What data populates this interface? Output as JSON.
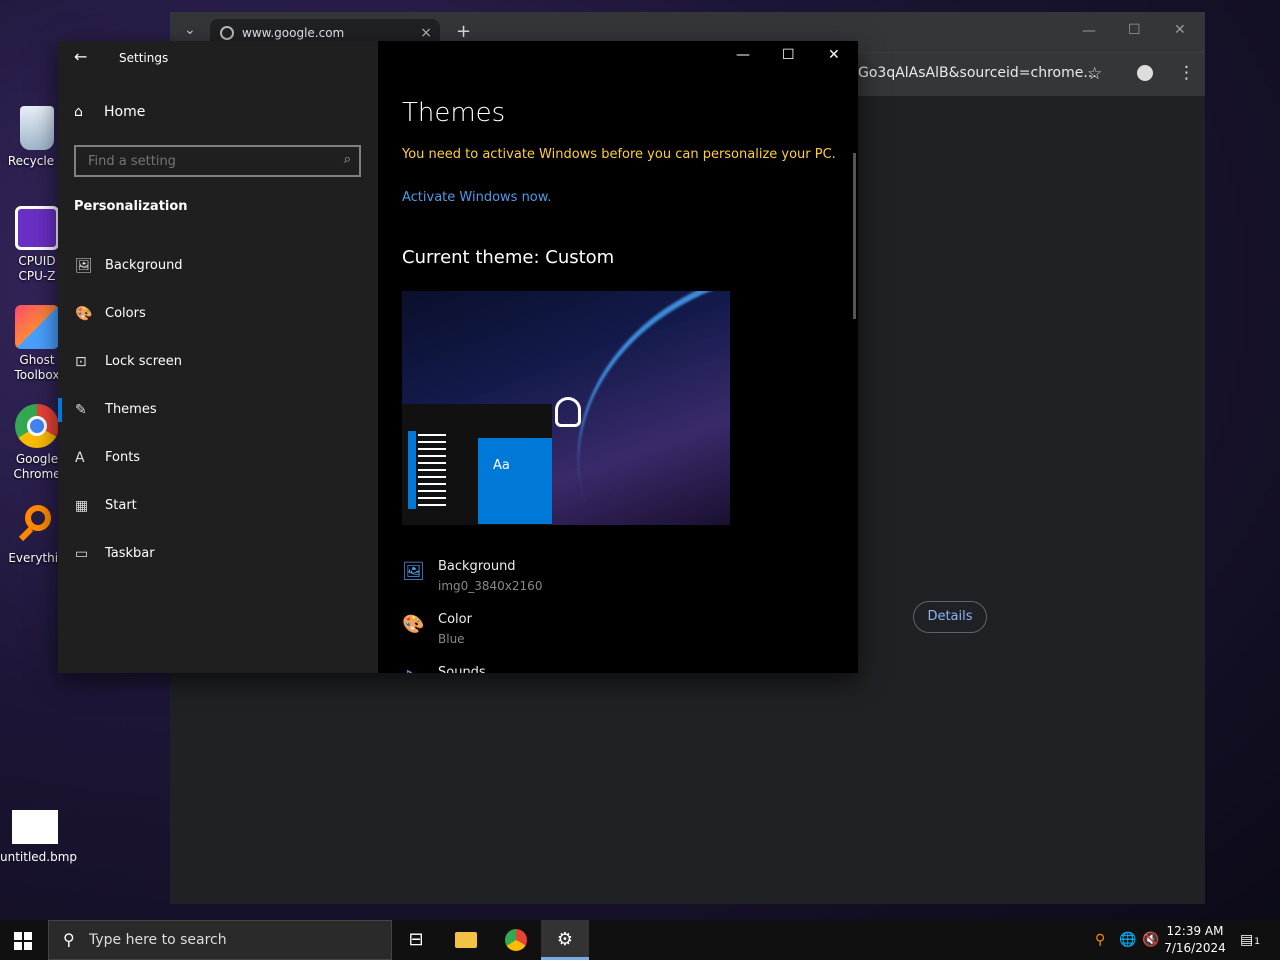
{
  "desktop": {
    "icons": [
      {
        "label": "Recycle B",
        "icon": "recycle-bin-icon"
      },
      {
        "label": "CPUID\nCPU-Z",
        "icon": "cpuz-icon"
      },
      {
        "label": "Ghost\nToolbox",
        "icon": "ghost-toolbox-icon"
      },
      {
        "label": "Google\nChrome",
        "icon": "chrome-icon"
      },
      {
        "label": "Everythin",
        "icon": "everything-search-icon"
      },
      {
        "label": "untitled.bmp",
        "icon": "bitmap-file-icon"
      }
    ]
  },
  "chrome": {
    "tab_title": "www.google.com",
    "tab_close": "×",
    "new_tab": "+",
    "url_fragment": "Go3qAlAsAlB&sourceid=chrome...",
    "details_label": "Details",
    "controls": {
      "minimize": "—",
      "maximize": "☐",
      "close": "✕"
    },
    "star": "☆",
    "menu": "⋮"
  },
  "settings": {
    "window_title": "Settings",
    "back": "←",
    "home_label": "Home",
    "search_placeholder": "Find a setting",
    "section_title": "Personalization",
    "nav": [
      {
        "label": "Background",
        "icon": "background-image-icon",
        "glyph": "🖼"
      },
      {
        "label": "Colors",
        "icon": "palette-icon",
        "glyph": "🎨"
      },
      {
        "label": "Lock screen",
        "icon": "lock-screen-icon",
        "glyph": "⊡"
      },
      {
        "label": "Themes",
        "icon": "themes-brush-icon",
        "glyph": "✎"
      },
      {
        "label": "Fonts",
        "icon": "fonts-icon",
        "glyph": "A"
      },
      {
        "label": "Start",
        "icon": "start-tiles-icon",
        "glyph": "▦"
      },
      {
        "label": "Taskbar",
        "icon": "taskbar-icon",
        "glyph": "▭"
      }
    ],
    "active_nav": "Themes",
    "page_title": "Themes",
    "activation_warning": "You need to activate Windows before you can personalize your PC.",
    "activate_link": "Activate Windows now.",
    "current_theme": "Current theme: Custom",
    "preview_tile_text": "Aa",
    "properties": [
      {
        "name": "Background",
        "value": "img0_3840x2160",
        "icon": "background-image-icon"
      },
      {
        "name": "Color",
        "value": "Blue",
        "icon": "palette-icon"
      },
      {
        "name": "Sounds",
        "value": "",
        "icon": "sound-icon"
      }
    ],
    "controls": {
      "minimize": "—",
      "maximize": "☐",
      "close": "✕"
    }
  },
  "taskbar": {
    "search_placeholder": "Type here to search",
    "time": "12:39 AM",
    "date": "7/16/2024",
    "notifications_count": "1"
  },
  "colors": {
    "accent": "#0078d7",
    "warning": "#ffcf3a",
    "link": "#4c9be8"
  }
}
